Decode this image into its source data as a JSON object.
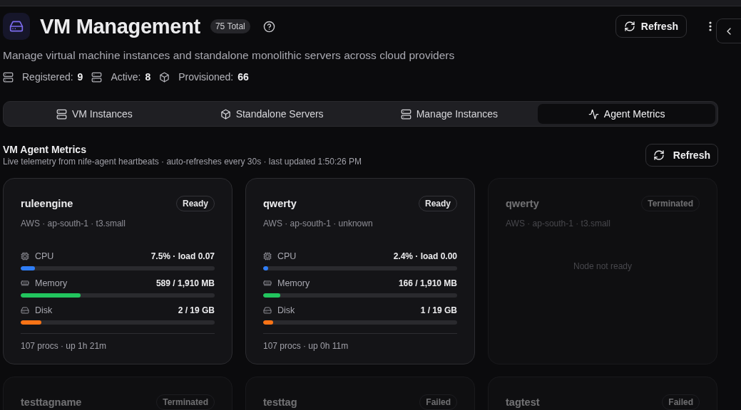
{
  "header": {
    "title": "VM Management",
    "total_badge": "75 Total",
    "refresh_button": "Refresh",
    "description": "Manage virtual machine instances and standalone monolithic servers across cloud providers",
    "stats": [
      {
        "kind": "server",
        "label": "Registered:",
        "value": "9"
      },
      {
        "kind": "server",
        "label": "Active:",
        "value": "8"
      },
      {
        "kind": "box",
        "label": "Provisioned:",
        "value": "66"
      }
    ]
  },
  "tabs": [
    {
      "kind": "server",
      "label": "VM Instances",
      "selected": false
    },
    {
      "kind": "box",
      "label": "Standalone Servers",
      "selected": false
    },
    {
      "kind": "server",
      "label": "Manage Instances",
      "selected": false
    },
    {
      "kind": "activity",
      "label": "Agent Metrics",
      "selected": true
    }
  ],
  "section": {
    "title": "VM Agent Metrics",
    "subtitle": "Live telemetry from nife-agent heartbeats · auto-refreshes every 30s · last updated 1:50:26 PM",
    "refresh_button": "Refresh"
  },
  "cards": [
    {
      "name": "ruleengine",
      "status": "Ready",
      "ready": true,
      "subtitle": "AWS · ap-south-1 · t3.small",
      "kind": "metrics",
      "metrics": [
        {
          "kind": "cpu",
          "label": "CPU",
          "reading": "7.5% · load 0.07",
          "level": 0.075,
          "color": "#2f7df6"
        },
        {
          "kind": "memory",
          "label": "Memory",
          "reading": "589 / 1,910 MB",
          "level": 0.308,
          "color": "#22c55e"
        },
        {
          "kind": "disk",
          "label": "Disk",
          "reading": "2 / 19 GB",
          "level": 0.105,
          "color": "#f97316"
        }
      ],
      "footer": "107 procs · up 1h 21m"
    },
    {
      "name": "qwerty",
      "status": "Ready",
      "ready": true,
      "subtitle": "AWS · ap-south-1 · unknown",
      "kind": "metrics",
      "metrics": [
        {
          "kind": "cpu",
          "label": "CPU",
          "reading": "2.4% · load 0.00",
          "level": 0.024,
          "color": "#2f7df6"
        },
        {
          "kind": "memory",
          "label": "Memory",
          "reading": "166 / 1,910 MB",
          "level": 0.087,
          "color": "#22c55e"
        },
        {
          "kind": "disk",
          "label": "Disk",
          "reading": "1 / 19 GB",
          "level": 0.053,
          "color": "#f97316"
        }
      ],
      "footer": "107 procs · up 0h 11m"
    },
    {
      "name": "qwerty",
      "status": "Terminated",
      "ready": false,
      "subtitle": "AWS · ap-south-1 · t3.small",
      "kind": "message",
      "message": "Node not ready"
    },
    {
      "name": "testtagname",
      "status": "Terminated",
      "ready": false
    },
    {
      "name": "testtag",
      "status": "Failed",
      "ready": false
    },
    {
      "name": "tagtest",
      "status": "Failed",
      "ready": false
    }
  ]
}
